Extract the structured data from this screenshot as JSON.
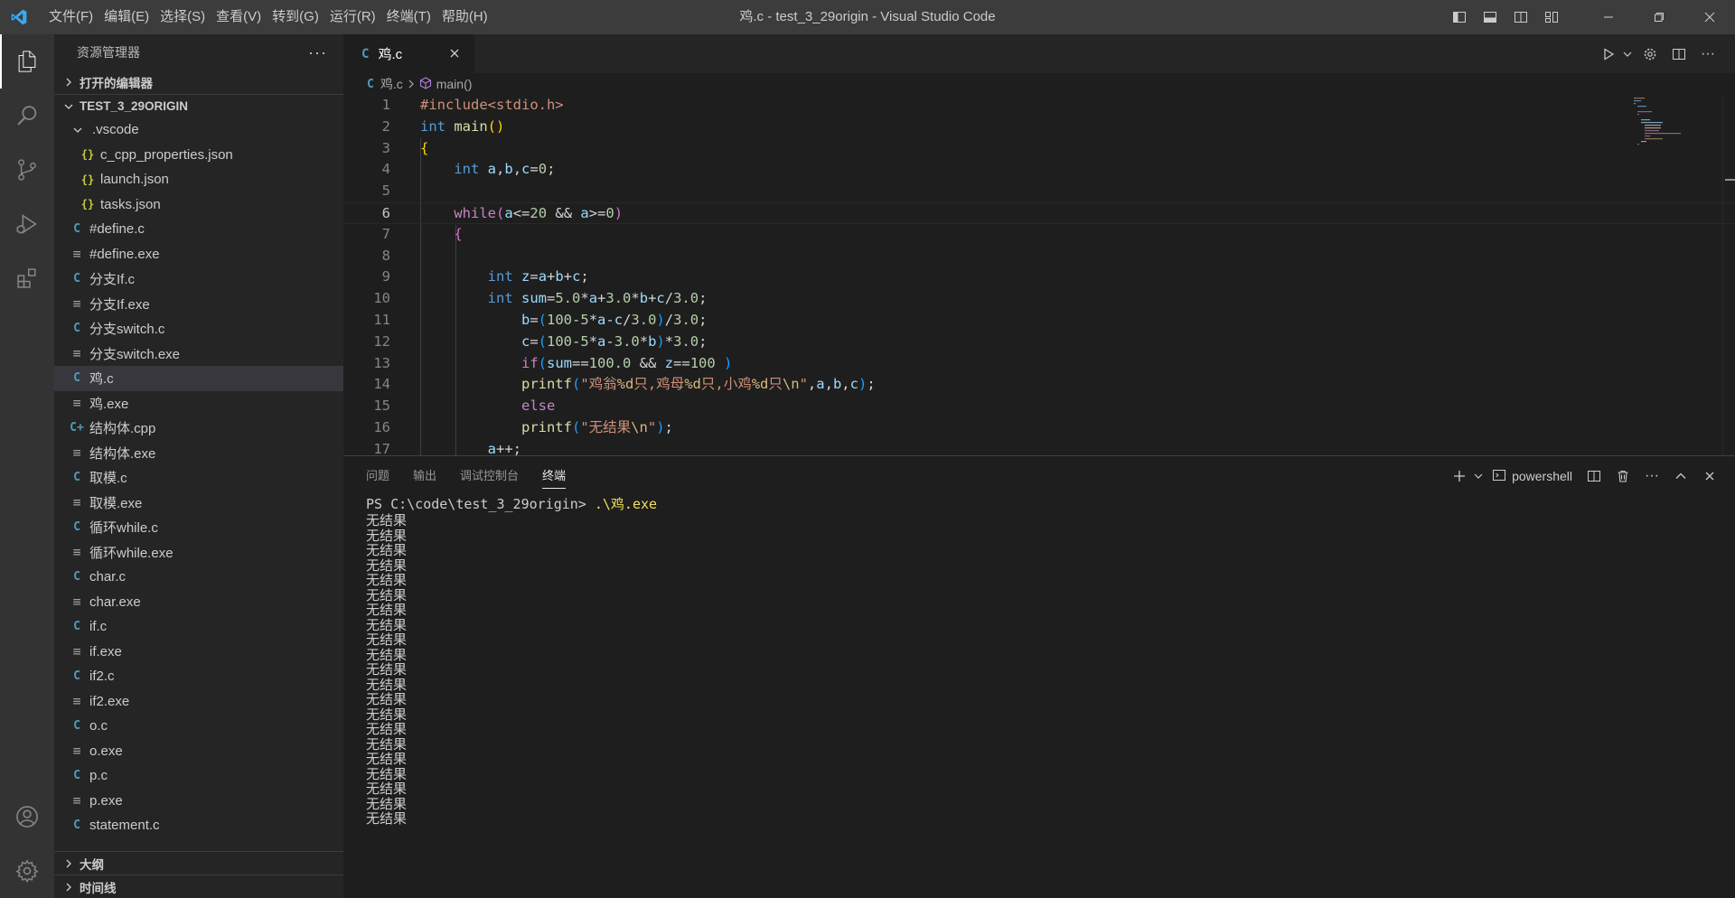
{
  "window": {
    "title": "鸡.c - test_3_29origin - Visual Studio Code",
    "menu": [
      "文件(F)",
      "编辑(E)",
      "选择(S)",
      "查看(V)",
      "转到(G)",
      "运行(R)",
      "终端(T)",
      "帮助(H)"
    ]
  },
  "sidebar": {
    "title": "资源管理器",
    "open_editors": "打开的编辑器",
    "folder": "TEST_3_29ORIGIN",
    "files": [
      {
        "name": ".vscode",
        "type": "folder-open",
        "icon": "chevron-down-icon"
      },
      {
        "name": "c_cpp_properties.json",
        "type": "json",
        "icon": "{}"
      },
      {
        "name": "launch.json",
        "type": "json",
        "icon": "{}"
      },
      {
        "name": "tasks.json",
        "type": "json",
        "icon": "{}"
      },
      {
        "name": "#define.c",
        "type": "c",
        "icon": "C"
      },
      {
        "name": "#define.exe",
        "type": "exe",
        "icon": "≡"
      },
      {
        "name": "分支If.c",
        "type": "c",
        "icon": "C"
      },
      {
        "name": "分支If.exe",
        "type": "exe",
        "icon": "≡"
      },
      {
        "name": "分支switch.c",
        "type": "c",
        "icon": "C"
      },
      {
        "name": "分支switch.exe",
        "type": "exe",
        "icon": "≡"
      },
      {
        "name": "鸡.c",
        "type": "c",
        "icon": "C",
        "selected": true
      },
      {
        "name": "鸡.exe",
        "type": "exe",
        "icon": "≡"
      },
      {
        "name": "结构体.cpp",
        "type": "cpp",
        "icon": "C+"
      },
      {
        "name": "结构体.exe",
        "type": "exe",
        "icon": "≡"
      },
      {
        "name": "取模.c",
        "type": "c",
        "icon": "C"
      },
      {
        "name": "取模.exe",
        "type": "exe",
        "icon": "≡"
      },
      {
        "name": "循环while.c",
        "type": "c",
        "icon": "C"
      },
      {
        "name": "循环while.exe",
        "type": "exe",
        "icon": "≡"
      },
      {
        "name": "char.c",
        "type": "c",
        "icon": "C"
      },
      {
        "name": "char.exe",
        "type": "exe",
        "icon": "≡"
      },
      {
        "name": "if.c",
        "type": "c",
        "icon": "C"
      },
      {
        "name": "if.exe",
        "type": "exe",
        "icon": "≡"
      },
      {
        "name": "if2.c",
        "type": "c",
        "icon": "C"
      },
      {
        "name": "if2.exe",
        "type": "exe",
        "icon": "≡"
      },
      {
        "name": "o.c",
        "type": "c",
        "icon": "C"
      },
      {
        "name": "o.exe",
        "type": "exe",
        "icon": "≡"
      },
      {
        "name": "p.c",
        "type": "c",
        "icon": "C"
      },
      {
        "name": "p.exe",
        "type": "exe",
        "icon": "≡"
      },
      {
        "name": "statement.c",
        "type": "c",
        "icon": "C"
      }
    ],
    "outline": "大纲",
    "timeline": "时间线"
  },
  "editor": {
    "tab_label": "鸡.c",
    "tab_icon": "C",
    "breadcrumb_file": "鸡.c",
    "breadcrumb_symbol": "main()",
    "current_line": 6,
    "lines": [
      {
        "n": 1,
        "tokens": [
          [
            "inc",
            "#include"
          ],
          [
            "inc",
            "<stdio.h>"
          ]
        ]
      },
      {
        "n": 2,
        "tokens": [
          [
            "kw",
            "int"
          ],
          [
            "txt",
            " "
          ],
          [
            "fn",
            "main"
          ],
          [
            "br1",
            "()"
          ]
        ]
      },
      {
        "n": 3,
        "tokens": [
          [
            "br1",
            "{"
          ]
        ]
      },
      {
        "n": 4,
        "tokens": [
          [
            "txt",
            "    "
          ],
          [
            "kw",
            "int"
          ],
          [
            "txt",
            " "
          ],
          [
            "var",
            "a"
          ],
          [
            "txt",
            ","
          ],
          [
            "var",
            "b"
          ],
          [
            "txt",
            ","
          ],
          [
            "var",
            "c"
          ],
          [
            "txt",
            "="
          ],
          [
            "num",
            "0"
          ],
          [
            "txt",
            ";"
          ]
        ]
      },
      {
        "n": 5,
        "tokens": []
      },
      {
        "n": 6,
        "tokens": [
          [
            "txt",
            "    "
          ],
          [
            "ctl",
            "while"
          ],
          [
            "br2",
            "("
          ],
          [
            "var",
            "a"
          ],
          [
            "txt",
            "<="
          ],
          [
            "num",
            "20"
          ],
          [
            "txt",
            " && "
          ],
          [
            "var",
            "a"
          ],
          [
            "txt",
            ">="
          ],
          [
            "num",
            "0"
          ],
          [
            "br2",
            ")"
          ]
        ]
      },
      {
        "n": 7,
        "tokens": [
          [
            "txt",
            "    "
          ],
          [
            "br2",
            "{"
          ]
        ]
      },
      {
        "n": 8,
        "tokens": []
      },
      {
        "n": 9,
        "tokens": [
          [
            "txt",
            "        "
          ],
          [
            "kw",
            "int"
          ],
          [
            "txt",
            " "
          ],
          [
            "var",
            "z"
          ],
          [
            "txt",
            "="
          ],
          [
            "var",
            "a"
          ],
          [
            "txt",
            "+"
          ],
          [
            "var",
            "b"
          ],
          [
            "txt",
            "+"
          ],
          [
            "var",
            "c"
          ],
          [
            "txt",
            ";"
          ]
        ]
      },
      {
        "n": 10,
        "tokens": [
          [
            "txt",
            "        "
          ],
          [
            "kw",
            "int"
          ],
          [
            "txt",
            " "
          ],
          [
            "var",
            "sum"
          ],
          [
            "txt",
            "="
          ],
          [
            "num",
            "5.0"
          ],
          [
            "txt",
            "*"
          ],
          [
            "var",
            "a"
          ],
          [
            "txt",
            "+"
          ],
          [
            "num",
            "3.0"
          ],
          [
            "txt",
            "*"
          ],
          [
            "var",
            "b"
          ],
          [
            "txt",
            "+"
          ],
          [
            "var",
            "c"
          ],
          [
            "txt",
            "/"
          ],
          [
            "num",
            "3.0"
          ],
          [
            "txt",
            ";"
          ]
        ]
      },
      {
        "n": 11,
        "tokens": [
          [
            "txt",
            "            "
          ],
          [
            "var",
            "b"
          ],
          [
            "txt",
            "="
          ],
          [
            "br3",
            "("
          ],
          [
            "num",
            "100"
          ],
          [
            "txt",
            "-"
          ],
          [
            "num",
            "5"
          ],
          [
            "txt",
            "*"
          ],
          [
            "var",
            "a"
          ],
          [
            "txt",
            "-"
          ],
          [
            "var",
            "c"
          ],
          [
            "txt",
            "/"
          ],
          [
            "num",
            "3.0"
          ],
          [
            "br3",
            ")"
          ],
          [
            "txt",
            "/"
          ],
          [
            "num",
            "3.0"
          ],
          [
            "txt",
            ";"
          ]
        ]
      },
      {
        "n": 12,
        "tokens": [
          [
            "txt",
            "            "
          ],
          [
            "var",
            "c"
          ],
          [
            "txt",
            "="
          ],
          [
            "br3",
            "("
          ],
          [
            "num",
            "100"
          ],
          [
            "txt",
            "-"
          ],
          [
            "num",
            "5"
          ],
          [
            "txt",
            "*"
          ],
          [
            "var",
            "a"
          ],
          [
            "txt",
            "-"
          ],
          [
            "num",
            "3.0"
          ],
          [
            "txt",
            "*"
          ],
          [
            "var",
            "b"
          ],
          [
            "br3",
            ")"
          ],
          [
            "txt",
            "*"
          ],
          [
            "num",
            "3.0"
          ],
          [
            "txt",
            ";"
          ]
        ]
      },
      {
        "n": 13,
        "tokens": [
          [
            "txt",
            "            "
          ],
          [
            "ctl",
            "if"
          ],
          [
            "br3",
            "("
          ],
          [
            "var",
            "sum"
          ],
          [
            "txt",
            "=="
          ],
          [
            "num",
            "100.0"
          ],
          [
            "txt",
            " && "
          ],
          [
            "var",
            "z"
          ],
          [
            "txt",
            "=="
          ],
          [
            "num",
            "100"
          ],
          [
            "txt",
            " "
          ],
          [
            "br3",
            ")"
          ]
        ]
      },
      {
        "n": 14,
        "tokens": [
          [
            "txt",
            "            "
          ],
          [
            "fn",
            "printf"
          ],
          [
            "br3",
            "("
          ],
          [
            "str",
            "\"鸡翁"
          ],
          [
            "esc",
            "%d"
          ],
          [
            "str",
            "只,鸡母"
          ],
          [
            "esc",
            "%d"
          ],
          [
            "str",
            "只,小鸡"
          ],
          [
            "esc",
            "%d"
          ],
          [
            "str",
            "只"
          ],
          [
            "esc",
            "\\n"
          ],
          [
            "str",
            "\""
          ],
          [
            "txt",
            ","
          ],
          [
            "var",
            "a"
          ],
          [
            "txt",
            ","
          ],
          [
            "var",
            "b"
          ],
          [
            "txt",
            ","
          ],
          [
            "var",
            "c"
          ],
          [
            "br3",
            ")"
          ],
          [
            "txt",
            ";"
          ]
        ]
      },
      {
        "n": 15,
        "tokens": [
          [
            "txt",
            "            "
          ],
          [
            "ctl",
            "else"
          ]
        ]
      },
      {
        "n": 16,
        "tokens": [
          [
            "txt",
            "            "
          ],
          [
            "fn",
            "printf"
          ],
          [
            "br3",
            "("
          ],
          [
            "str",
            "\"无结果"
          ],
          [
            "esc",
            "\\n"
          ],
          [
            "str",
            "\""
          ],
          [
            "br3",
            ")"
          ],
          [
            "txt",
            ";"
          ]
        ]
      },
      {
        "n": 17,
        "tokens": [
          [
            "txt",
            "        "
          ],
          [
            "var",
            "a"
          ],
          [
            "txt",
            "++;"
          ]
        ]
      }
    ]
  },
  "panel": {
    "tabs": [
      "问题",
      "输出",
      "调试控制台",
      "终端"
    ],
    "active_tab": "终端",
    "terminal_label": "powershell",
    "prompt": "PS C:\\code\\test_3_29origin> ",
    "command": ".\\鸡.exe",
    "output_line": "无结果",
    "output_count": 21
  },
  "colors": {
    "accent": "#007acc",
    "c_icon": "#519aba",
    "json_icon": "#cbcb41"
  }
}
